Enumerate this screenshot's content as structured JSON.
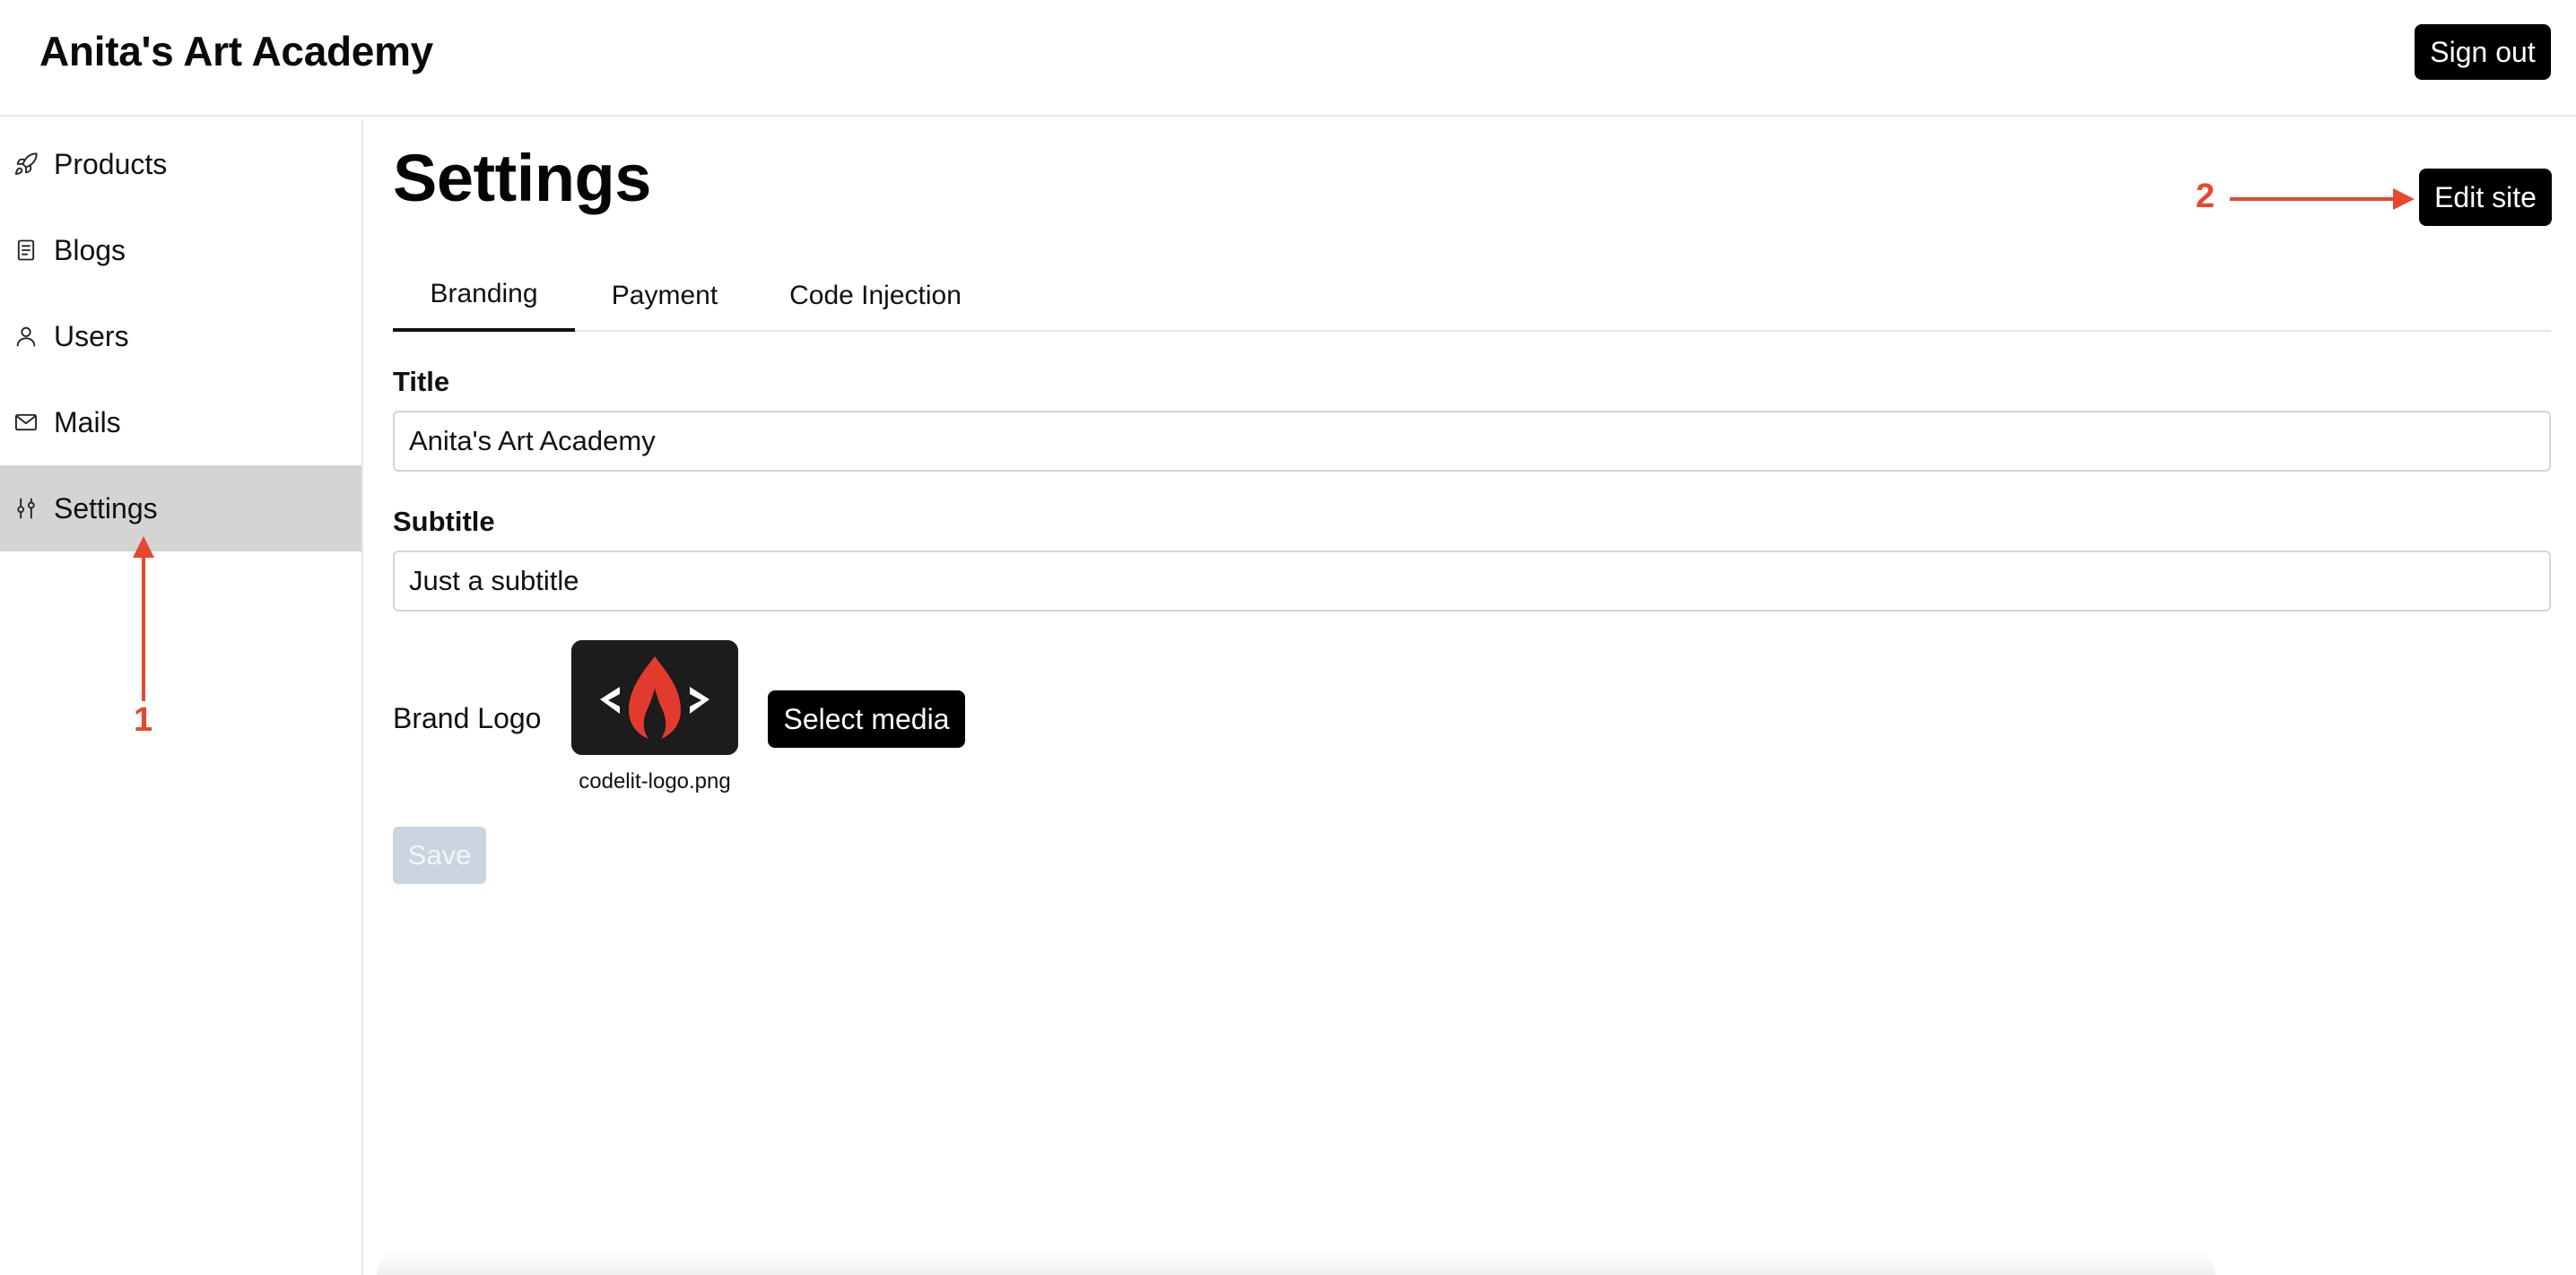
{
  "header": {
    "app_title": "Anita's Art Academy",
    "signout_label": "Sign out"
  },
  "sidebar": {
    "items": [
      {
        "label": "Products",
        "icon": "rocket-icon",
        "active": false
      },
      {
        "label": "Blogs",
        "icon": "document-icon",
        "active": false
      },
      {
        "label": "Users",
        "icon": "user-icon",
        "active": false
      },
      {
        "label": "Mails",
        "icon": "mail-icon",
        "active": false
      },
      {
        "label": "Settings",
        "icon": "sliders-icon",
        "active": true
      }
    ]
  },
  "main": {
    "page_title": "Settings",
    "edit_site_label": "Edit site",
    "tabs": [
      {
        "label": "Branding",
        "active": true
      },
      {
        "label": "Payment",
        "active": false
      },
      {
        "label": "Code Injection",
        "active": false
      }
    ],
    "form": {
      "title_label": "Title",
      "title_value": "Anita's Art Academy",
      "subtitle_label": "Subtitle",
      "subtitle_value": "Just a subtitle",
      "brand_logo_label": "Brand Logo",
      "logo_filename": "codelit-logo.png",
      "select_media_label": "Select media",
      "save_label": "Save"
    }
  },
  "annotations": [
    {
      "number": "1",
      "target": "Settings sidebar item"
    },
    {
      "number": "2",
      "target": "Edit site button"
    }
  ],
  "colors": {
    "accent": "#000000",
    "active_nav": "#d4d4d4",
    "annotation": "#e8472f",
    "disabled_button": "#cbd5e1",
    "logo_flame": "#e23b2e"
  }
}
